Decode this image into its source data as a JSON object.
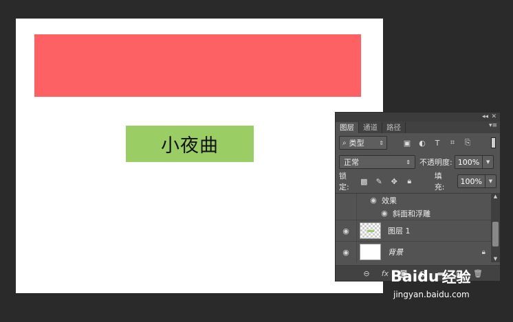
{
  "canvas": {
    "green_label": "小夜曲",
    "colors": {
      "red": "#fe6163",
      "green": "#9acd63",
      "background": "#ffffff"
    }
  },
  "panel": {
    "controls": {
      "collapse": "◂◂",
      "close": "✕"
    },
    "tabs": [
      {
        "label": "图层",
        "active": true
      },
      {
        "label": "通道",
        "active": false
      },
      {
        "label": "路径",
        "active": false
      }
    ],
    "filter": {
      "label": "类型",
      "icons": [
        "image-icon",
        "adjustment-icon",
        "type-icon",
        "shape-icon",
        "smart-object-icon"
      ]
    },
    "blend_mode": "正常",
    "opacity_label": "不透明度:",
    "opacity_value": "100%",
    "lock_label": "锁定:",
    "fill_label": "填充:",
    "fill_value": "100%",
    "layers": {
      "effects_label": "效果",
      "bevel_label": "斜面和浮雕",
      "items": [
        {
          "name": "图层 1"
        },
        {
          "name": "背景"
        }
      ]
    },
    "bottom_icons": [
      "link-icon",
      "fx-icon",
      "mask-icon",
      "adjustment-layer-icon",
      "group-icon",
      "new-layer-icon",
      "trash-icon"
    ]
  },
  "watermark": {
    "brand": "Baidu",
    "brand_cn": "经验",
    "url": "jingyan.baidu.com"
  }
}
